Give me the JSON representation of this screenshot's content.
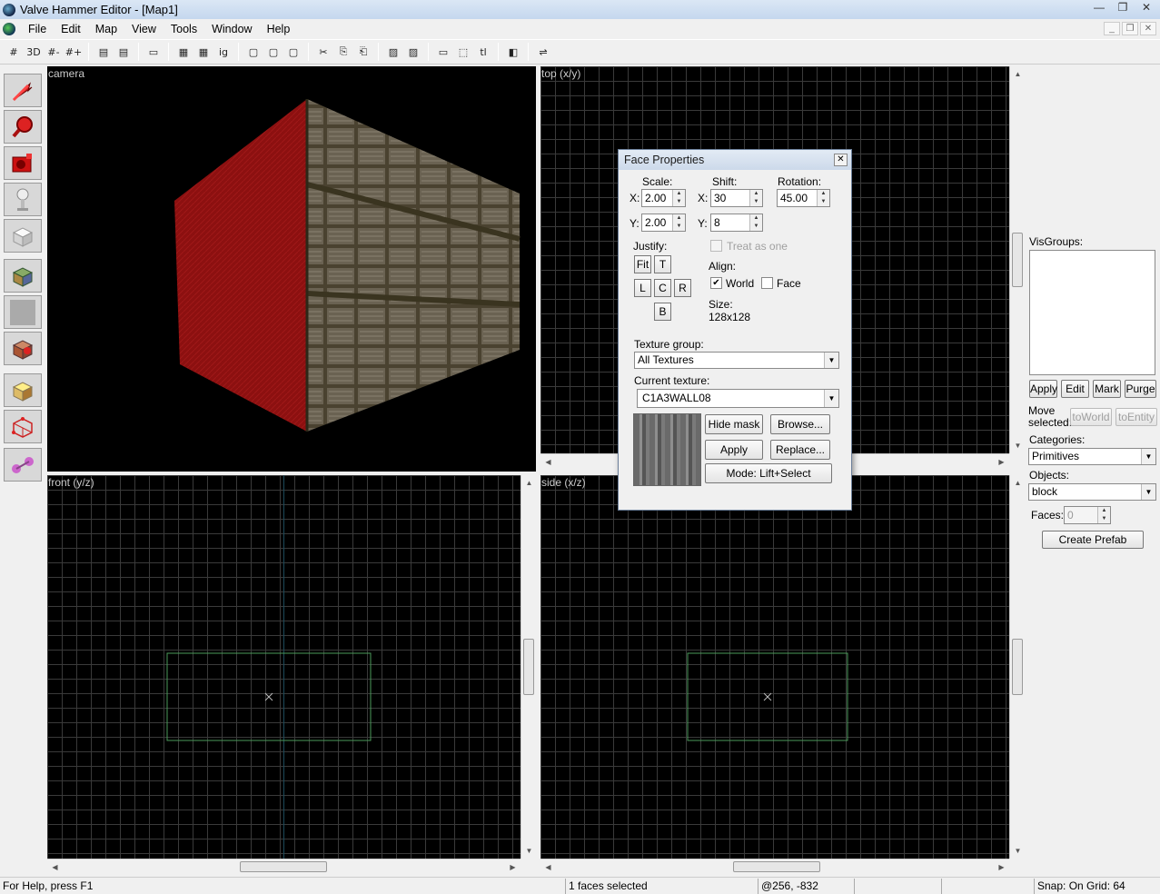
{
  "window": {
    "title": "Valve Hammer Editor - [Map1]",
    "min": "—",
    "max": "❐",
    "close": "✕"
  },
  "mdi": {
    "min": "_",
    "restore": "❐",
    "close": "✕"
  },
  "menu": [
    "File",
    "Edit",
    "Map",
    "View",
    "Tools",
    "Window",
    "Help"
  ],
  "toolbar": [
    "#",
    "3D",
    "#-",
    "#+",
    "▤",
    "▤",
    "▭",
    "▦",
    "▦",
    "ig",
    "▢",
    "▢",
    "▢",
    "✂",
    "⎘",
    "⎗",
    "▨",
    "▨",
    "▭",
    "⬚",
    "tl",
    "◧",
    "⇌"
  ],
  "viewports": {
    "camera": "camera",
    "top": "top (x/y)",
    "front": "front (y/z)",
    "side": "side (x/z)"
  },
  "face_properties": {
    "title": "Face Properties",
    "scale_label": "Scale:",
    "shift_label": "Shift:",
    "rotation_label": "Rotation:",
    "x": "X:",
    "y": "Y:",
    "scale_x": "2.00",
    "scale_y": "2.00",
    "shift_x": "30",
    "shift_y": "8",
    "rotation": "45.00",
    "justify_label": "Justify:",
    "justify_buttons": {
      "fit": "Fit",
      "t": "T",
      "l": "L",
      "c": "C",
      "r": "R",
      "b": "B"
    },
    "treat_as_one": "Treat as one",
    "align_label": "Align:",
    "world": "World",
    "face": "Face",
    "world_checked": true,
    "face_checked": false,
    "size_label": "Size:",
    "size_value": "128x128",
    "texture_group_label": "Texture group:",
    "texture_group": "All Textures",
    "current_texture_label": "Current texture:",
    "current_texture": "C1A3WALL08",
    "hide_mask": "Hide mask",
    "browse": "Browse...",
    "apply": "Apply",
    "replace": "Replace...",
    "mode": "Mode: Lift+Select"
  },
  "right_panel": {
    "visgroups_label": "VisGroups:",
    "apply": "Apply",
    "edit": "Edit",
    "mark": "Mark",
    "purge": "Purge",
    "move_selected": "Move selected:",
    "to_world": "toWorld",
    "to_entity": "toEntity",
    "categories_label": "Categories:",
    "categories_value": "Primitives",
    "objects_label": "Objects:",
    "objects_value": "block",
    "faces_label": "Faces:",
    "faces_value": "0",
    "create_prefab": "Create Prefab"
  },
  "status": {
    "help": "For Help, press F1",
    "selection": "1 faces selected",
    "coords": "@256, -832",
    "snap": "Snap: On Grid: 64"
  },
  "colors": {
    "viewport_bg": "#000000",
    "grid": "#3a3a3a",
    "brush_outline": "#4a9a5a",
    "face_red": "#8c1010"
  }
}
